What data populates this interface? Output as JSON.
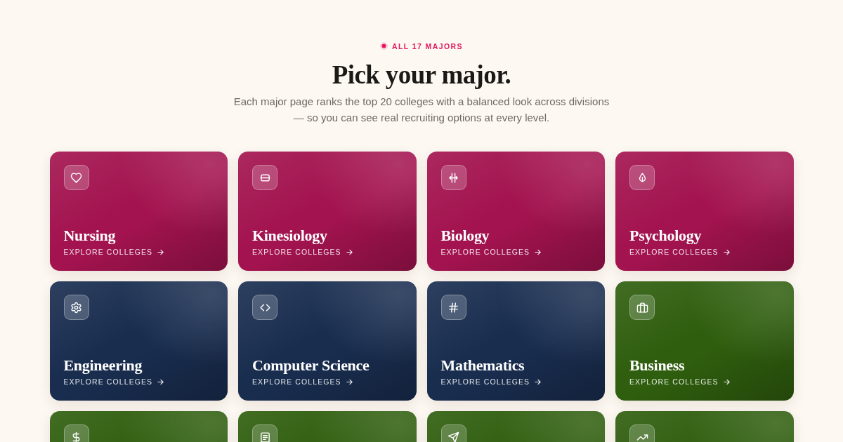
{
  "header": {
    "badge": "ALL 17 MAJORS",
    "title": "Pick your major.",
    "description": "Each major page ranks the top 20 colleges with a balanced look across divisions — so you can see real recruiting options at every level."
  },
  "cards": [
    {
      "title": "Nursing",
      "link": "EXPLORE COLLEGES",
      "color": "#a3134f"
    },
    {
      "title": "Kinesiology",
      "link": "EXPLORE COLLEGES",
      "color": "#a3134f"
    },
    {
      "title": "Biology",
      "link": "EXPLORE COLLEGES",
      "color": "#a3134f"
    },
    {
      "title": "Psychology",
      "link": "EXPLORE COLLEGES",
      "color": "#a3134f"
    },
    {
      "title": "Engineering",
      "link": "EXPLORE COLLEGES",
      "color": "#192d4f"
    },
    {
      "title": "Computer Science",
      "link": "EXPLORE COLLEGES",
      "color": "#192d4f"
    },
    {
      "title": "Mathematics",
      "link": "EXPLORE COLLEGES",
      "color": "#192d4f"
    },
    {
      "title": "Business",
      "link": "EXPLORE COLLEGES",
      "color": "#2f5e0e"
    },
    {
      "color": "#2f5e0e"
    },
    {
      "color": "#2f5e0e"
    },
    {
      "color": "#2f5e0e"
    },
    {
      "color": "#2f5e0e"
    }
  ]
}
